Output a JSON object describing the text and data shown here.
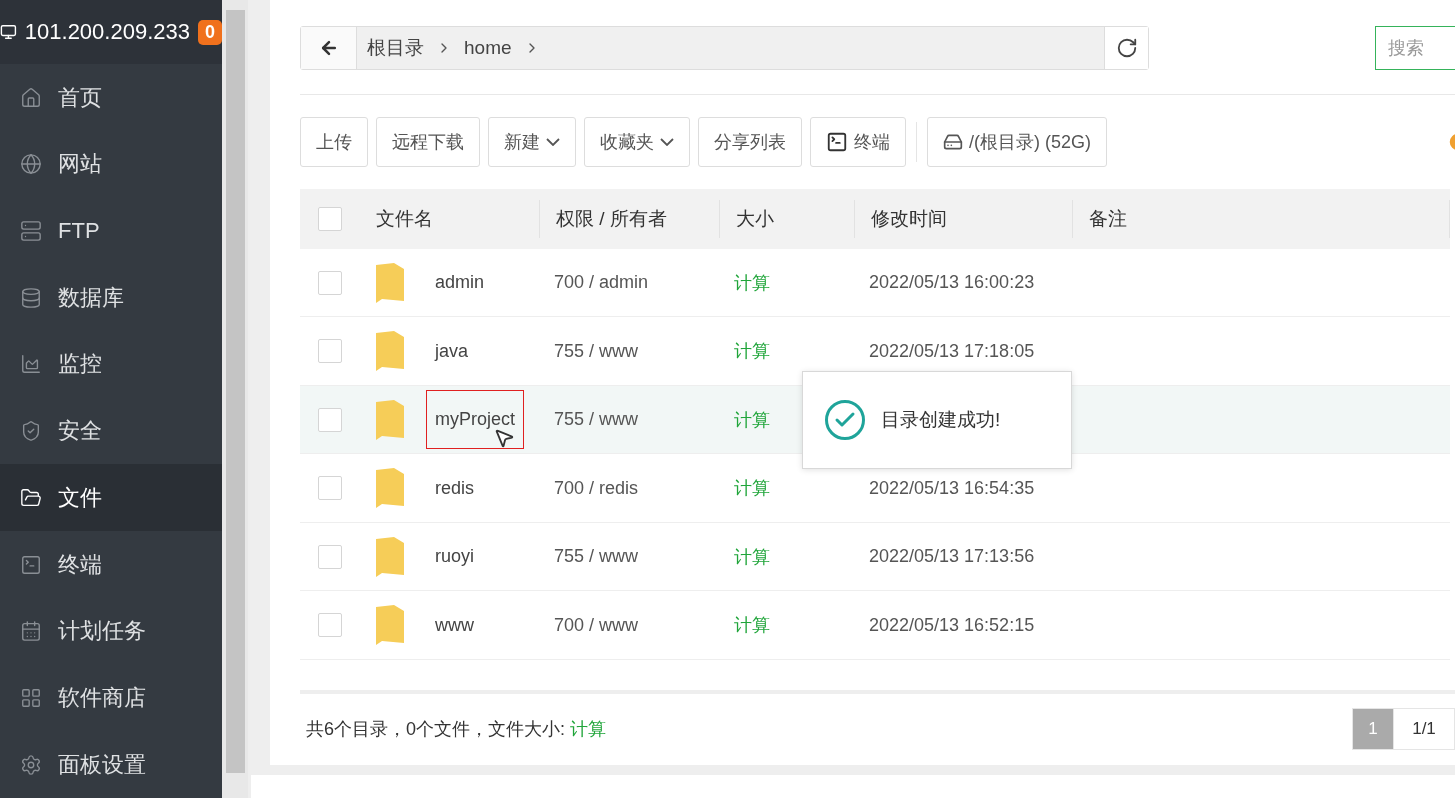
{
  "server": {
    "address": "101.200.209.233",
    "badge": "0"
  },
  "sidebar": {
    "items": [
      {
        "label": "首页",
        "selected": false
      },
      {
        "label": "网站",
        "selected": false
      },
      {
        "label": "FTP",
        "selected": false
      },
      {
        "label": "数据库",
        "selected": false
      },
      {
        "label": "监控",
        "selected": false
      },
      {
        "label": "安全",
        "selected": false
      },
      {
        "label": "文件",
        "selected": true
      },
      {
        "label": "终端",
        "selected": false
      },
      {
        "label": "计划任务",
        "selected": false
      },
      {
        "label": "软件商店",
        "selected": false
      },
      {
        "label": "面板设置",
        "selected": false
      }
    ]
  },
  "breadcrumb": [
    "根目录",
    "home"
  ],
  "search": {
    "placeholder": "搜索"
  },
  "toolbar": [
    {
      "kind": "plain",
      "label": "上传"
    },
    {
      "kind": "plain",
      "label": "远程下载"
    },
    {
      "kind": "dropdown",
      "label": "新建"
    },
    {
      "kind": "dropdown",
      "label": "收藏夹"
    },
    {
      "kind": "plain",
      "label": "分享列表"
    },
    {
      "kind": "terminal",
      "label": "终端"
    },
    {
      "kind": "disk",
      "label": "/(根目录) (52G)"
    }
  ],
  "table": {
    "header_checked": false,
    "columns": [
      "文件名",
      "权限 / 所有者",
      "大小",
      "修改时间",
      "备注"
    ],
    "rows": [
      {
        "name": "admin",
        "perms": "700 / admin",
        "size": "计算",
        "modified": "2022/05/13 16:00:23",
        "checked": false,
        "hovered": false,
        "annotated": false
      },
      {
        "name": "java",
        "perms": "755 / www",
        "size": "计算",
        "modified": "2022/05/13 17:18:05",
        "checked": false,
        "hovered": false,
        "annotated": false
      },
      {
        "name": "myProject",
        "perms": "755 / www",
        "size": "计算",
        "checked": false,
        "hovered": true,
        "annotated": true
      },
      {
        "name": "redis",
        "perms": "700 / redis",
        "size": "计算",
        "modified": "2022/05/13 16:54:35",
        "checked": false,
        "hovered": false,
        "annotated": false
      },
      {
        "name": "ruoyi",
        "perms": "755 / www",
        "size": "计算",
        "modified": "2022/05/13 17:13:56",
        "checked": false,
        "hovered": false,
        "annotated": false
      },
      {
        "name": "www",
        "perms": "700 / www",
        "size": "计算",
        "modified": "2022/05/13 16:52:15",
        "checked": false,
        "hovered": false,
        "annotated": false
      }
    ]
  },
  "footer": {
    "summary": "共6个目录，0个文件，文件大小: ",
    "size_link": "计算"
  },
  "pagination": {
    "pages": [
      {
        "label": "1",
        "selected": true
      }
    ],
    "total": "1/1"
  },
  "toast": {
    "message": "目录创建成功!"
  }
}
